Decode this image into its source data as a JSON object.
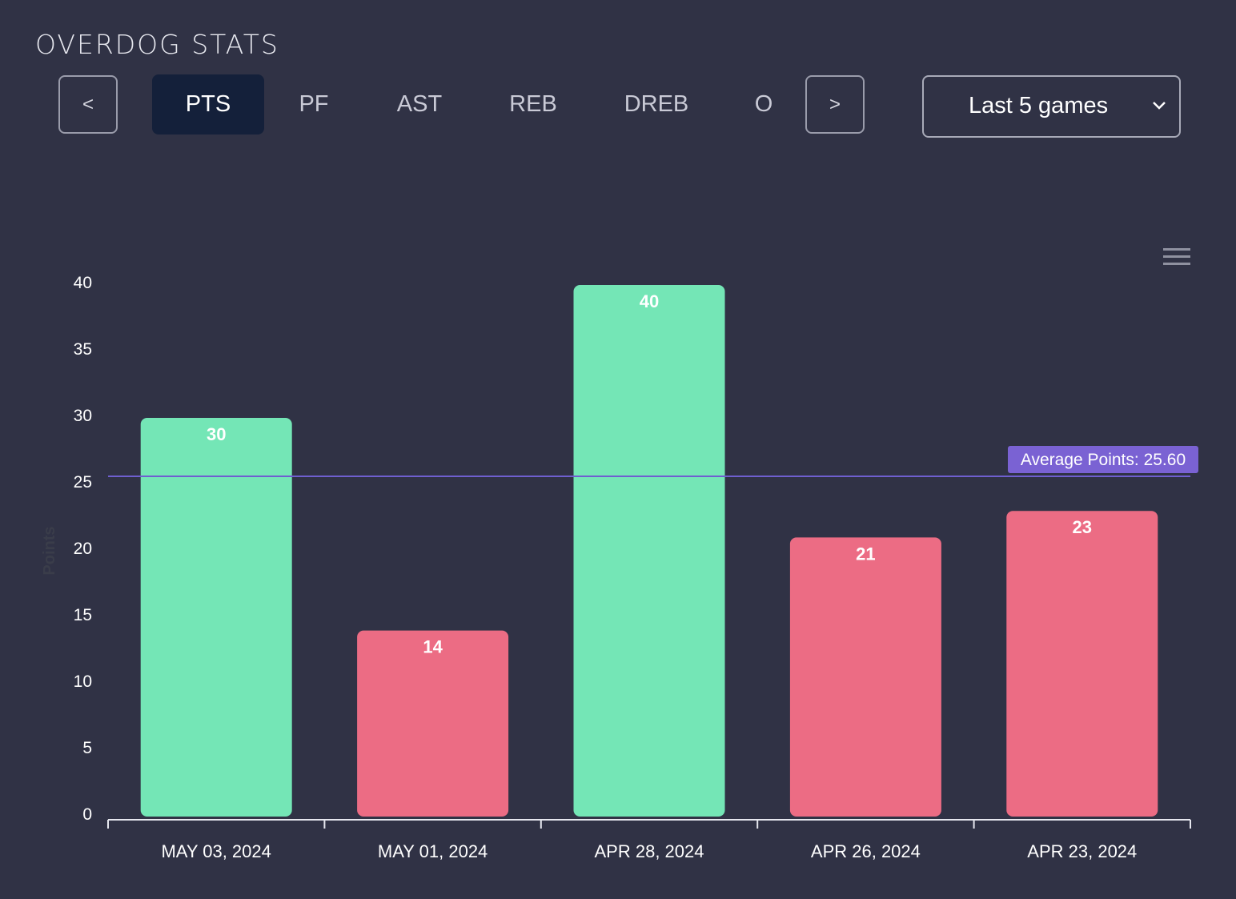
{
  "brand": {
    "logo_text": "OVERDOG STATS"
  },
  "nav": {
    "prev_label": "<",
    "next_label": ">"
  },
  "tabs": [
    {
      "label": "PTS",
      "active": true
    },
    {
      "label": "PF",
      "active": false
    },
    {
      "label": "AST",
      "active": false
    },
    {
      "label": "REB",
      "active": false
    },
    {
      "label": "DREB",
      "active": false
    },
    {
      "label": "O",
      "active": false
    }
  ],
  "range_select": {
    "selected": "Last 5 games"
  },
  "colors": {
    "background": "#303245",
    "above_average": "#74e6b6",
    "below_average": "#ec6c84",
    "average_line": "#6f5fd0",
    "average_label_bg": "#7a62d3",
    "axis_text": "#ffffff"
  },
  "chart_data": {
    "type": "bar",
    "categories": [
      "MAY 03, 2024",
      "MAY 01, 2024",
      "APR 28, 2024",
      "APR 26, 2024",
      "APR 23, 2024"
    ],
    "values": [
      30,
      14,
      40,
      21,
      23
    ],
    "ylabel": "Points",
    "ylim": [
      0,
      40
    ],
    "yticks": [
      0,
      5,
      10,
      15,
      20,
      25,
      30,
      35,
      40
    ],
    "average": {
      "value": 25.6,
      "label": "Average Points: 25.60"
    },
    "data_labels": true,
    "grid": false,
    "legend": "none"
  }
}
